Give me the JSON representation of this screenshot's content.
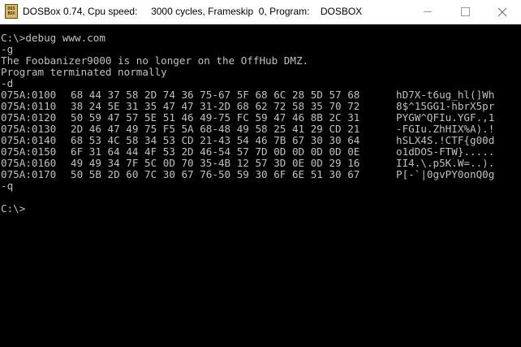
{
  "window": {
    "title": "DOSBox 0.74, Cpu speed:     3000 cycles, Frameskip  0, Program:    DOSBOX",
    "icon_text": "DOS BOX"
  },
  "console": {
    "lines_top": [
      "C:\\>debug www.com",
      "-g",
      "The Foobanizer9000 is no longer on the OffHub DMZ.",
      "Program terminated normally",
      "-d"
    ],
    "dump": [
      {
        "addr": "075A:0100",
        "hex": "68 44 37 58 2D 74 36 75-67 5F 68 6C 28 5D 57 68",
        "ascii": "hD7X-t6ug_hl(]Wh"
      },
      {
        "addr": "075A:0110",
        "hex": "38 24 5E 31 35 47 47 31-2D 68 62 72 58 35 70 72",
        "ascii": "8$^15GG1-hbrX5pr"
      },
      {
        "addr": "075A:0120",
        "hex": "50 59 47 57 5E 51 46 49-75 FC 59 47 46 8B 2C 31",
        "ascii": "PYGW^QFIu.YGF.,1"
      },
      {
        "addr": "075A:0130",
        "hex": "2D 46 47 49 75 F5 5A 68-48 49 58 25 41 29 CD 21",
        "ascii": "-FGIu.ZhHIX%A).!"
      },
      {
        "addr": "075A:0140",
        "hex": "68 53 4C 58 34 53 CD 21-43 54 46 7B 67 30 30 64",
        "ascii": "hSLX4S.!CTF{g00d"
      },
      {
        "addr": "075A:0150",
        "hex": "6F 31 64 44 4F 53 2D 46-54 57 7D 0D 0D 0D 0D 0E",
        "ascii": "o1dDOS-FTW}....."
      },
      {
        "addr": "075A:0160",
        "hex": "49 49 34 7F 5C 0D 70 35-4B 12 57 3D 0E 0D 29 16",
        "ascii": "II4.\\.p5K.W=..)."
      },
      {
        "addr": "075A:0170",
        "hex": "50 5B 2D 60 7C 30 67 76-50 59 30 6F 6E 51 30 67",
        "ascii": "P[-`|0gvPY0onQ0g"
      }
    ],
    "lines_bottom": [
      "-q",
      "",
      "C:\\>"
    ]
  }
}
